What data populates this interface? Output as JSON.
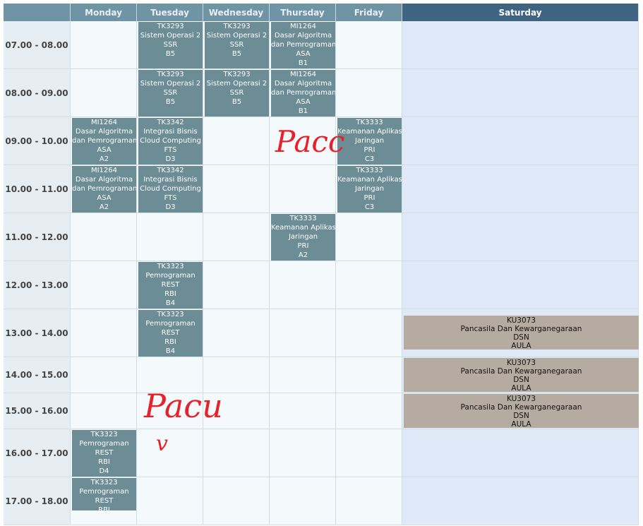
{
  "days": [
    "Monday",
    "Tuesday",
    "Wednesday",
    "Thursday",
    "Friday",
    "Saturday"
  ],
  "times": [
    "07.00 - 08.00",
    "08.00 - 09.00",
    "09.00 - 10.00",
    "10.00 - 11.00",
    "11.00 - 12.00",
    "12.00 - 13.00",
    "13.00 - 14.00",
    "14.00 - 15.00",
    "15.00 - 16.00",
    "16.00 - 17.00",
    "17.00 - 18.00"
  ],
  "classes": [
    {
      "day": 1,
      "slot": 0,
      "lines": [
        "TK3293",
        "Sistem Operasi 2",
        "SSR",
        "B5"
      ]
    },
    {
      "day": 2,
      "slot": 0,
      "lines": [
        "TK3293",
        "Sistem Operasi 2",
        "SSR",
        "B5"
      ]
    },
    {
      "day": 3,
      "slot": 0,
      "lines": [
        "MI1264",
        "Dasar Algoritma",
        "dan Pemrograman",
        "ASA",
        "B1"
      ]
    },
    {
      "day": 1,
      "slot": 1,
      "lines": [
        "TK3293",
        "Sistem Operasi 2",
        "SSR",
        "B5"
      ]
    },
    {
      "day": 2,
      "slot": 1,
      "lines": [
        "TK3293",
        "Sistem Operasi 2",
        "SSR",
        "B5"
      ]
    },
    {
      "day": 3,
      "slot": 1,
      "lines": [
        "MI1264",
        "Dasar Algoritma",
        "dan Pemrograman",
        "ASA",
        "B1"
      ]
    },
    {
      "day": 0,
      "slot": 2,
      "lines": [
        "MI1264",
        "Dasar Algoritma",
        "dan Pemrograman",
        "ASA",
        "A2"
      ]
    },
    {
      "day": 1,
      "slot": 2,
      "lines": [
        "TK3342",
        "Integrasi Bisnis",
        "Cloud Computing",
        "FTS",
        "D3"
      ]
    },
    {
      "day": 4,
      "slot": 2,
      "lines": [
        "TK3333",
        "Keamanan Aplikasi",
        "Jaringan",
        "PRI",
        "C3"
      ]
    },
    {
      "day": 0,
      "slot": 3,
      "lines": [
        "MI1264",
        "Dasar Algoritma",
        "dan Pemrograman",
        "ASA",
        "A2"
      ]
    },
    {
      "day": 1,
      "slot": 3,
      "lines": [
        "TK3342",
        "Integrasi Bisnis",
        "Cloud Computing",
        "FTS",
        "D3"
      ]
    },
    {
      "day": 4,
      "slot": 3,
      "lines": [
        "TK3333",
        "Keamanan Aplikasi",
        "Jaringan",
        "PRI",
        "C3"
      ]
    },
    {
      "day": 3,
      "slot": 4,
      "lines": [
        "TK3333",
        "Keamanan Aplikasi",
        "Jaringan",
        "PRI",
        "A2"
      ]
    },
    {
      "day": 1,
      "slot": 5,
      "lines": [
        "TK3323",
        "Pemrograman",
        "REST",
        "RBI",
        "B4"
      ]
    },
    {
      "day": 1,
      "slot": 6,
      "lines": [
        "TK3323",
        "Pemrograman",
        "REST",
        "RBI",
        "B4"
      ]
    },
    {
      "day": 0,
      "slot": 9,
      "lines": [
        "TK3323",
        "Pemrograman",
        "REST",
        "RBI",
        "D4"
      ]
    },
    {
      "day": 0,
      "slot": 10,
      "lines": [
        "TK3323",
        "Pemrograman",
        "REST",
        "RBI"
      ]
    },
    {
      "day": 5,
      "slot": 6,
      "lines": [
        "KU3073",
        "Pancasila Dan Kewarganegaraan",
        "DSN",
        "AULA"
      ]
    },
    {
      "day": 5,
      "slot": 7,
      "lines": [
        "KU3073",
        "Pancasila Dan Kewarganegaraan",
        "DSN",
        "AULA"
      ]
    },
    {
      "day": 5,
      "slot": 8,
      "lines": [
        "KU3073",
        "Pancasila Dan Kewarganegaraan",
        "DSN",
        "AULA"
      ]
    }
  ],
  "annotations": [
    "Pacc",
    "Pacu",
    "v"
  ],
  "colors": {
    "header": "#6f94a6",
    "header_saturday": "#3e6481",
    "class_block": "#6c8c96",
    "saturday_block": "#b5aba0",
    "annotation": "#e8202a"
  }
}
